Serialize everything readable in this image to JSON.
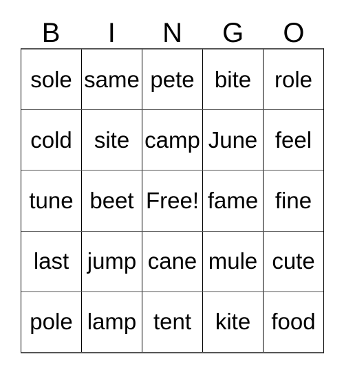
{
  "card": {
    "header_letters": [
      "B",
      "I",
      "N",
      "G",
      "O"
    ],
    "free_space_label": "Free!",
    "colors": {
      "text": "#000000",
      "border": "#555555",
      "background": "#ffffff"
    },
    "rows": [
      {
        "cells": [
          "sole",
          "same",
          "pete",
          "bite",
          "role"
        ]
      },
      {
        "cells": [
          "cold",
          "site",
          "camp",
          "June",
          "feel"
        ]
      },
      {
        "cells": [
          "tune",
          "beet",
          "Free!",
          "fame",
          "fine"
        ]
      },
      {
        "cells": [
          "last",
          "jump",
          "cane",
          "mule",
          "cute"
        ]
      },
      {
        "cells": [
          "pole",
          "lamp",
          "tent",
          "kite",
          "food"
        ]
      }
    ]
  }
}
